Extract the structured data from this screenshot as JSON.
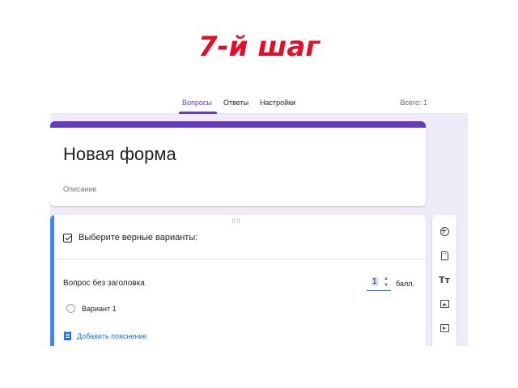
{
  "slide": {
    "title": "7-й шаг"
  },
  "header": {
    "tabs": [
      {
        "label": "Вопросы",
        "active": true
      },
      {
        "label": "Ответы",
        "active": false
      },
      {
        "label": "Настройки",
        "active": false
      }
    ],
    "total": "Всего: 1"
  },
  "form": {
    "title": "Новая форма",
    "description_placeholder": "Описание"
  },
  "question": {
    "type_label": "Выберите верные варианты:",
    "title_placeholder": "Вопрос без заголовка",
    "points_value": "1",
    "points_label": "балл.",
    "options": [
      {
        "label": "Вариант 1"
      }
    ],
    "add_explanation_label": "Добавить пояснение"
  },
  "toolbar": {
    "icons": [
      "add-question-icon",
      "import-questions-icon",
      "add-title-icon",
      "add-image-icon",
      "add-video-icon"
    ]
  },
  "colors": {
    "accent_purple": "#673ab7",
    "active_blue": "#4285f4",
    "link_blue": "#1a73e8",
    "slide_title_red": "#e0102a",
    "canvas_bg": "#f0ebf8"
  }
}
